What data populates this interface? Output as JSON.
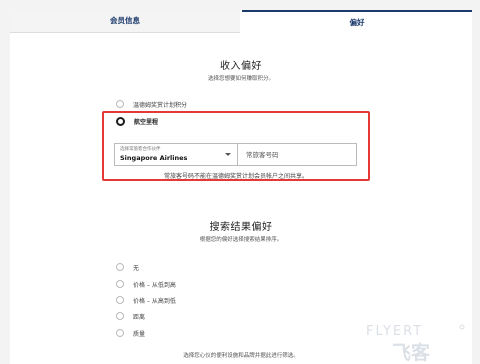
{
  "tabs": [
    {
      "label": "会员信息",
      "active": false
    },
    {
      "label": "偏好",
      "active": true
    }
  ],
  "earn": {
    "heading": "收入偏好",
    "subheading": "选择您想要如何赚取积分。",
    "options": [
      {
        "label": "温德姆奖赏计划积分",
        "checked": false
      },
      {
        "label": "航空里程",
        "checked": true
      }
    ],
    "partner_select": {
      "label": "选择常旅客合作伙伴",
      "value": "Singapore Airlines"
    },
    "frequent_flyer_placeholder": "常旅客号码",
    "note": "常旅客号码不能在温德姆奖赏计划会员帐户之间共享。"
  },
  "search": {
    "heading": "搜索结果偏好",
    "subheading": "根据您的偏好选择搜索结果排序。",
    "options": [
      {
        "label": "无",
        "checked": false
      },
      {
        "label": "价格 – 从低到高",
        "checked": false
      },
      {
        "label": "价格 – 从高到低",
        "checked": false
      },
      {
        "label": "距离",
        "checked": false
      },
      {
        "label": "质量",
        "checked": false
      }
    ],
    "footer_note": "选择您心仪的便利设施和品牌并据此进行筛选。"
  },
  "watermark": {
    "text_top": "FLYERT",
    "text_bottom": "飞客"
  },
  "colors": {
    "accent": "#1c3a6b",
    "highlight": "#e53935"
  }
}
